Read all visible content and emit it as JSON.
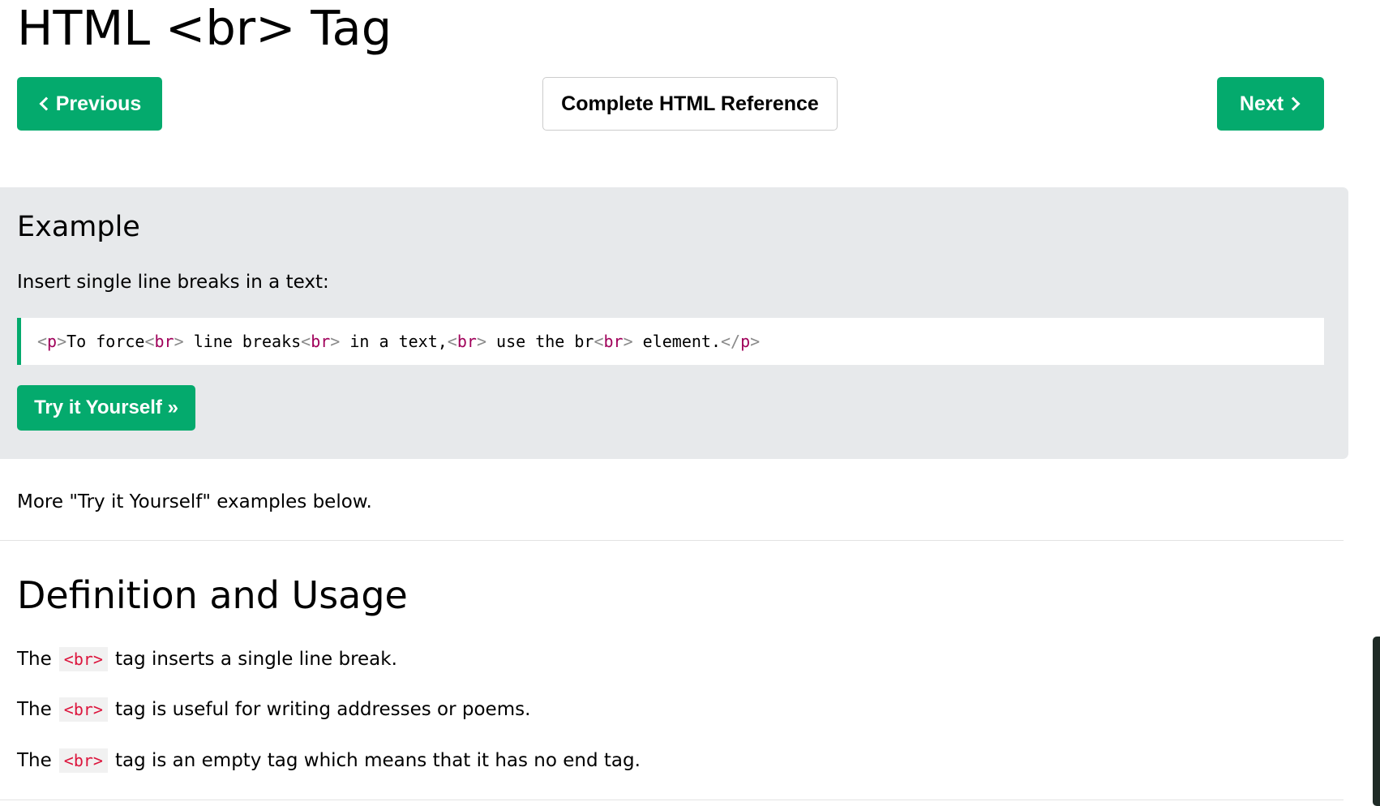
{
  "page": {
    "title": "HTML <br> Tag"
  },
  "nav": {
    "previous_label": "Previous",
    "reference_label": "Complete HTML Reference",
    "next_label": "Next"
  },
  "example": {
    "heading": "Example",
    "intro": "Insert single line breaks in a text:",
    "code_tokens": [
      {
        "text": "<",
        "kind": "bracket"
      },
      {
        "text": "p",
        "kind": "tagname"
      },
      {
        "text": ">",
        "kind": "bracket"
      },
      {
        "text": "To force",
        "kind": "text"
      },
      {
        "text": "<",
        "kind": "bracket"
      },
      {
        "text": "br",
        "kind": "tagname"
      },
      {
        "text": ">",
        "kind": "bracket"
      },
      {
        "text": " line breaks",
        "kind": "text"
      },
      {
        "text": "<",
        "kind": "bracket"
      },
      {
        "text": "br",
        "kind": "tagname"
      },
      {
        "text": ">",
        "kind": "bracket"
      },
      {
        "text": " in a text,",
        "kind": "text"
      },
      {
        "text": "<",
        "kind": "bracket"
      },
      {
        "text": "br",
        "kind": "tagname"
      },
      {
        "text": ">",
        "kind": "bracket"
      },
      {
        "text": " use the br",
        "kind": "text"
      },
      {
        "text": "<",
        "kind": "bracket"
      },
      {
        "text": "br",
        "kind": "tagname"
      },
      {
        "text": ">",
        "kind": "bracket"
      },
      {
        "text": " element.",
        "kind": "text"
      },
      {
        "text": "</",
        "kind": "bracket"
      },
      {
        "text": "p",
        "kind": "tagname"
      },
      {
        "text": ">",
        "kind": "bracket"
      }
    ],
    "try_label": "Try it Yourself »"
  },
  "more_examples_text": "More \"Try it Yourself\" examples below.",
  "definition": {
    "heading": "Definition and Usage",
    "lines": [
      {
        "prefix": "The",
        "code": "<br>",
        "suffix": "tag inserts a single line break."
      },
      {
        "prefix": "The",
        "code": "<br>",
        "suffix": "tag is useful for writing addresses or poems."
      },
      {
        "prefix": "The",
        "code": "<br>",
        "suffix": "tag is an empty tag which means that it has no end tag."
      }
    ]
  },
  "colors": {
    "accent_green": "#04aa6d",
    "panel_gray": "#e7e9eb",
    "inline_code_red": "#dc143c",
    "code_tag_color": "#a0005a"
  },
  "icons": {
    "previous": "chevron-left-icon",
    "next": "chevron-right-icon"
  }
}
